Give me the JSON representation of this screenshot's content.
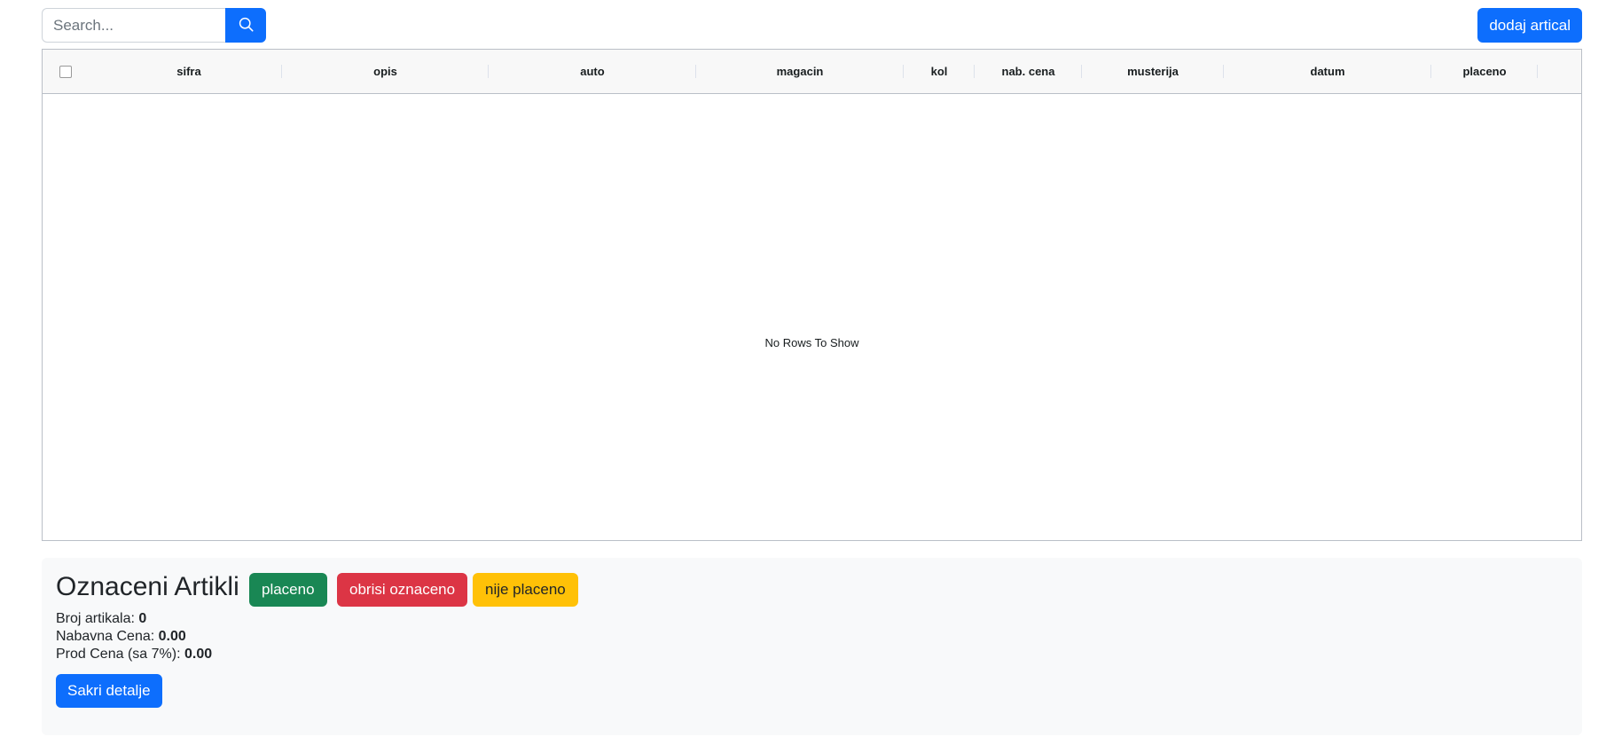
{
  "toolbar": {
    "search_placeholder": "Search...",
    "search_value": "",
    "search_icon": "search-icon",
    "add_button_label": "dodaj artical"
  },
  "grid": {
    "columns": [
      "sifra",
      "opis",
      "auto",
      "magacin",
      "kol",
      "nab. cena",
      "musterija",
      "datum",
      "placeno"
    ],
    "rows": [],
    "empty_message": "No Rows To Show"
  },
  "summary": {
    "title": "Oznaceni Artikli",
    "buttons": {
      "paid": "placeno",
      "delete": "obrisi oznaceno",
      "unpaid": "nije placeno"
    },
    "stats": [
      {
        "label": "Broj artikala:",
        "value": "0"
      },
      {
        "label": "Nabavna Cena:",
        "value": "0.00"
      },
      {
        "label": "Prod Cena (sa 7%):",
        "value": "0.00"
      }
    ],
    "hide_details_label": "Sakri detalje"
  },
  "colors": {
    "primary": "#0d6efd",
    "success": "#198754",
    "danger": "#dc3545",
    "warning": "#ffc107"
  }
}
